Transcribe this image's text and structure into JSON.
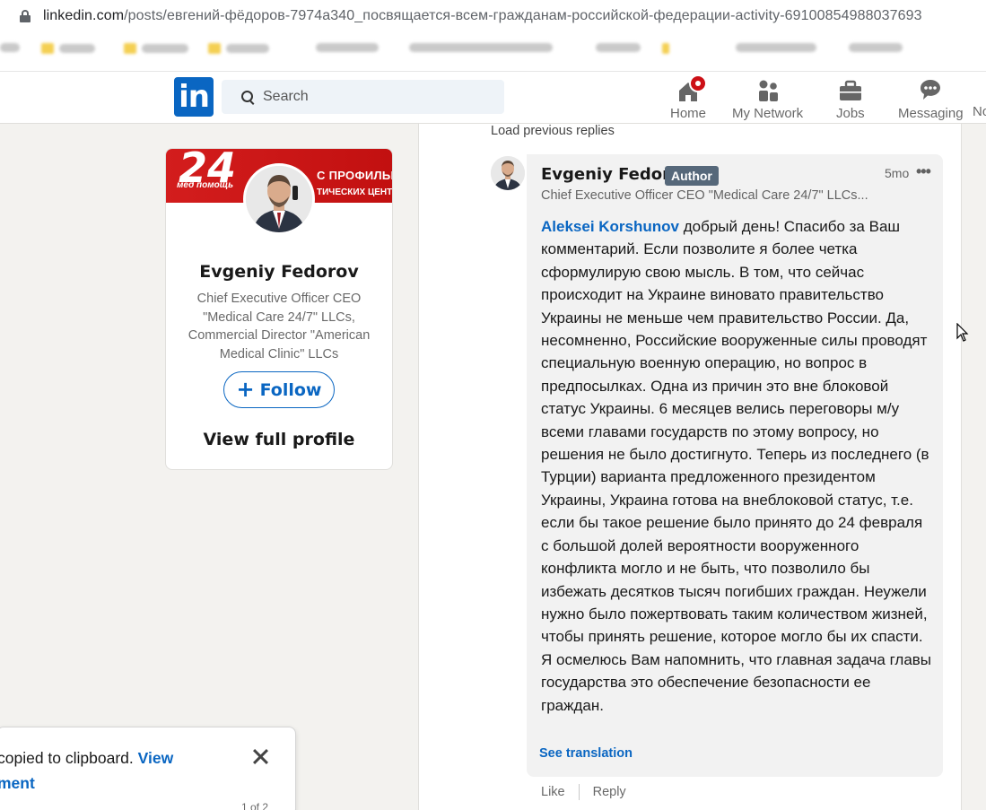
{
  "browser": {
    "url_host": "linkedin.com",
    "url_path": "/posts/евгений-фёдоров-7974a340_посвящается-всем-гражданам-российской-федерации-activity-69100854988037693"
  },
  "nav": {
    "logo": "in",
    "search_placeholder": "Search",
    "items": [
      {
        "label": "Home",
        "icon": "home-icon"
      },
      {
        "label": "My Network",
        "icon": "network-icon"
      },
      {
        "label": "Jobs",
        "icon": "briefcase-icon"
      },
      {
        "label": "Messaging",
        "icon": "messaging-icon"
      },
      {
        "label": "No"
      }
    ]
  },
  "profile_card": {
    "banner_number": "24",
    "banner_subtitle": "мед помощь",
    "banner_line1": "С ПРОФИЛЬНЫХ",
    "banner_line2": "ТИЧЕСКИХ ЦЕНТРОВ",
    "name": "Evgeniy Fedorov",
    "headline": "Chief Executive Officer CEO \"Medical Care 24/7\" LLCs, Commercial Director \"American Medical Clinic\" LLCs",
    "follow_label": "Follow",
    "view_profile_label": "View full profile"
  },
  "comments": {
    "load_previous": "Load previous replies",
    "reply": {
      "author": "Evgeniy Fedorov",
      "badge": "Author",
      "time": "5mo",
      "subtitle": "Chief Executive Officer CEO \"Medical Care 24/7\" LLCs...",
      "mention": "Aleksei Korshunov",
      "text": " добрый день! Спасибо за Ваш комментарий. Если позволите я более четка сформулирую свою мысль. В том, что сейчас происходит на Украине виновато правительство Украины не меньше чем правительство России. Да, несомненно, Российские вооруженные силы проводят специальную военную операцию, но вопрос в предпосылках. Одна из причин это вне блоковой статус Украины. 6 месяцев велись переговоры м/у всеми главами государств по этому вопросу, но решения не было достигнуто. Теперь из последнего (в Турции) варианта предложенного президентом Украины, Украина готова на внеблоковой статус, т.е. если бы такое решение было принято до 24 февраля с большой долей вероятности вооруженного конфликта могло и не быть, что позволило бы избежать десятков тысяч погибших граждан. Неужели нужно было пожертвовать таким количеством жизней, чтобы принять решение, которое могло бы их спасти. Я осмелюсь Вам напомнить, что главная задача главы государства это обеспечение безопасности ее граждан.",
      "see_translation": "See translation",
      "like_label": "Like",
      "reply_label": "Reply"
    }
  },
  "toast": {
    "text_prefix": "copied to clipboard.",
    "link_part1": "View",
    "link_part2": "ment",
    "counter": "1 of 2"
  },
  "colors": {
    "linkedin_blue": "#0a66c2",
    "notification_red": "#cc1016",
    "author_badge": "#56687a",
    "banner_red": "#d31d1d"
  }
}
